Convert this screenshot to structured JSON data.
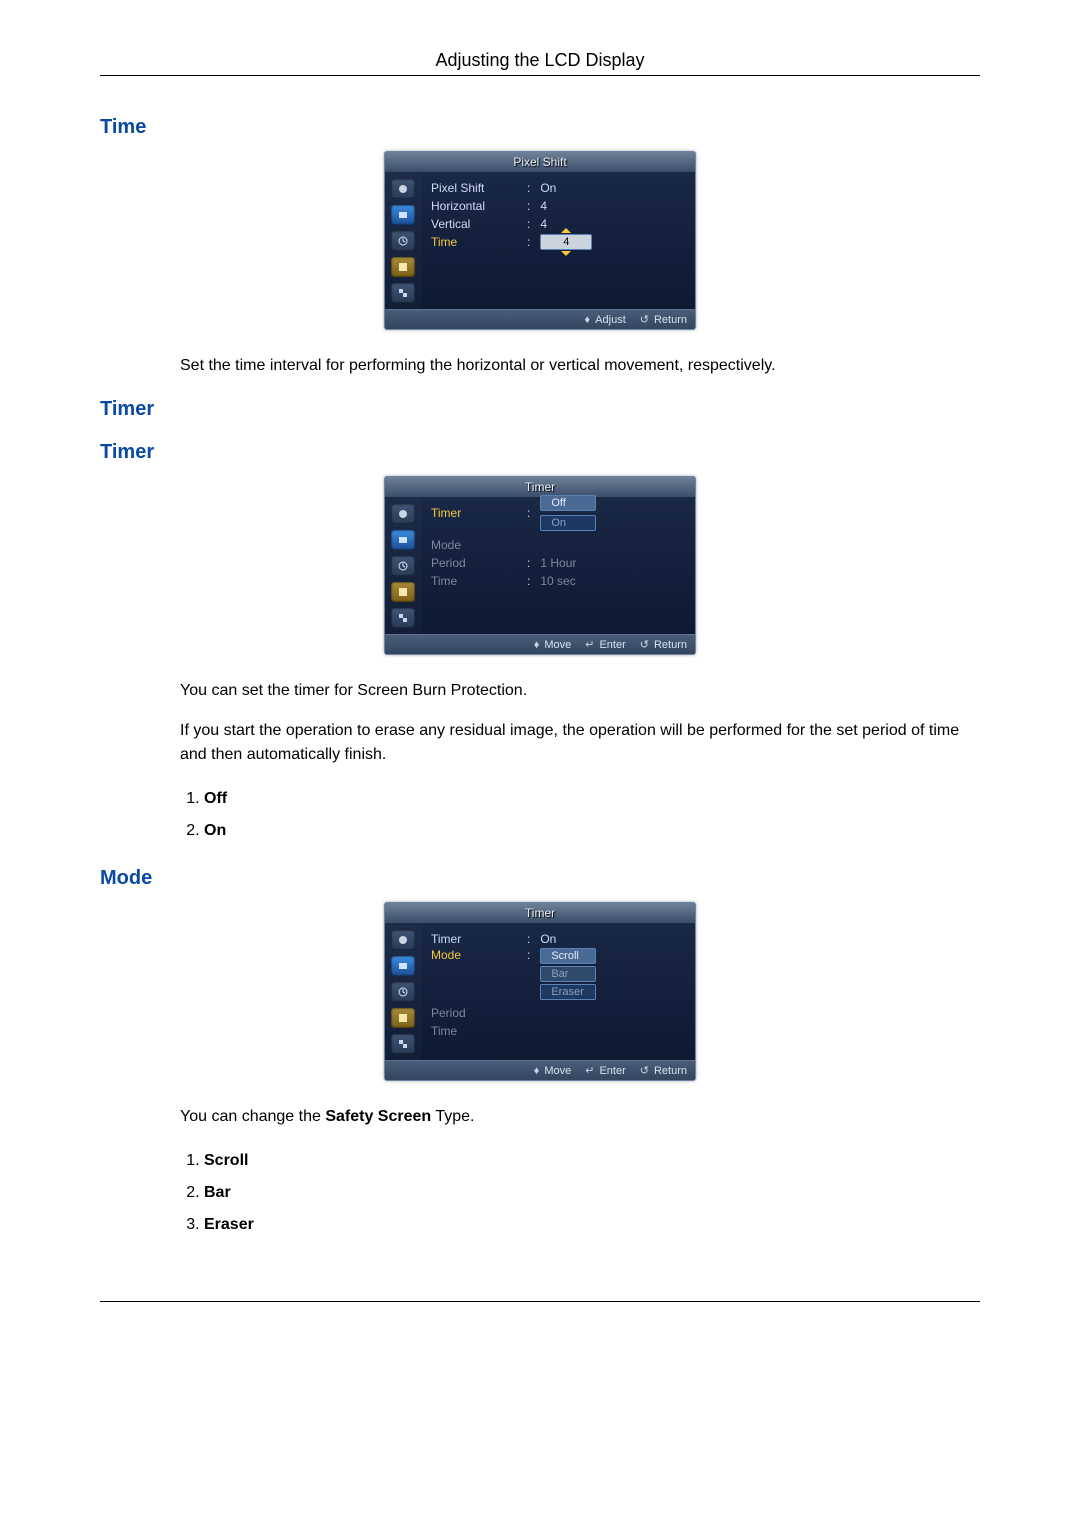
{
  "header": {
    "title": "Adjusting the LCD Display"
  },
  "sections": {
    "time": {
      "title": "Time",
      "desc": "Set the time interval for performing the horizontal or vertical movement, respectively."
    },
    "timer1": {
      "title": "Timer"
    },
    "timer2": {
      "title": "Timer",
      "desc1": "You can set the timer for Screen Burn Protection.",
      "desc2": "If you start the operation to erase any residual image, the operation will be performed for the set period of time and then automatically finish.",
      "list": [
        "Off",
        "On"
      ]
    },
    "mode": {
      "title": "Mode",
      "desc_pre": "You can change the ",
      "desc_bold": "Safety Screen",
      "desc_post": " Type.",
      "list": [
        "Scroll",
        "Bar",
        "Eraser"
      ]
    }
  },
  "osd_time": {
    "title": "Pixel Shift",
    "rows": {
      "pixel_shift": {
        "label": "Pixel Shift",
        "value": "On"
      },
      "horizontal": {
        "label": "Horizontal",
        "value": "4"
      },
      "vertical": {
        "label": "Vertical",
        "value": "4"
      },
      "time": {
        "label": "Time",
        "value": "4"
      }
    },
    "footer": {
      "adjust": "Adjust",
      "return": "Return"
    }
  },
  "osd_timer": {
    "title": "Timer",
    "rows": {
      "timer": {
        "label": "Timer",
        "opts": [
          "Off",
          "On"
        ]
      },
      "mode": {
        "label": "Mode"
      },
      "period": {
        "label": "Period",
        "value": "1 Hour"
      },
      "time": {
        "label": "Time",
        "value": "10 sec"
      }
    },
    "footer": {
      "move": "Move",
      "enter": "Enter",
      "return": "Return"
    }
  },
  "osd_mode": {
    "title": "Timer",
    "rows": {
      "timer": {
        "label": "Timer",
        "value": "On"
      },
      "mode": {
        "label": "Mode",
        "opts": [
          "Scroll",
          "Bar",
          "Eraser"
        ]
      },
      "period": {
        "label": "Period"
      },
      "time": {
        "label": "Time"
      }
    },
    "footer": {
      "move": "Move",
      "enter": "Enter",
      "return": "Return"
    }
  }
}
